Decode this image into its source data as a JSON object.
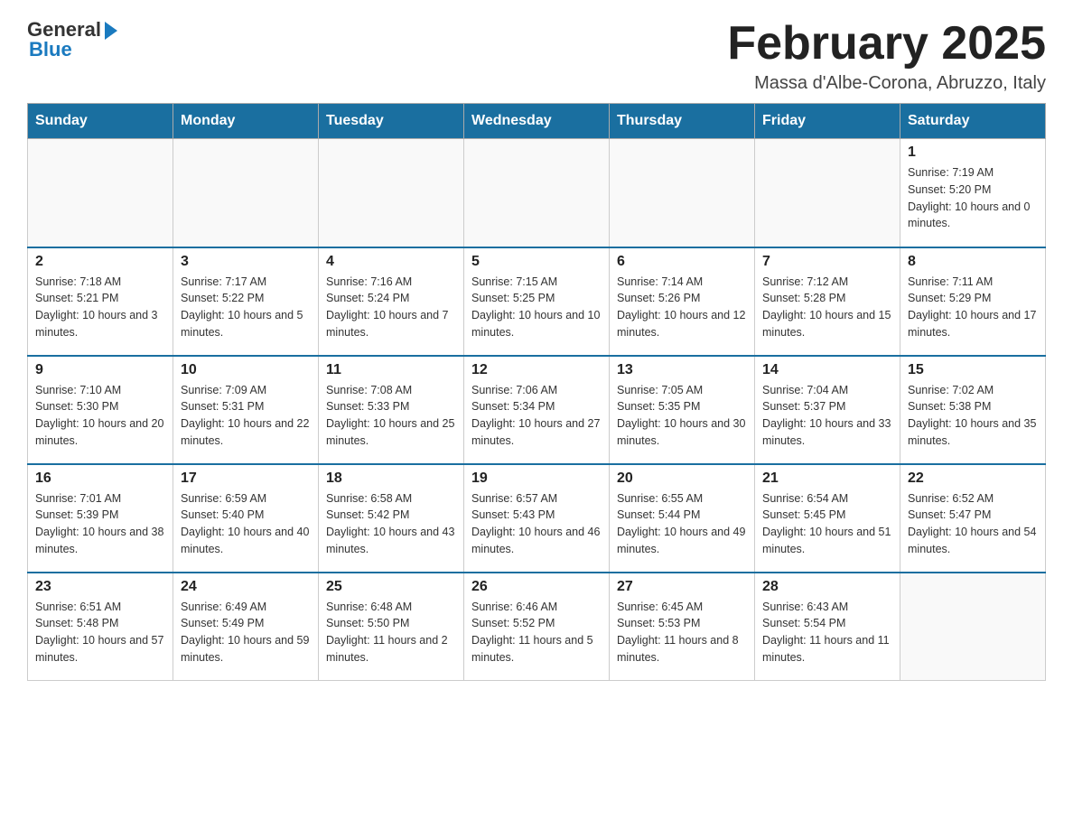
{
  "logo": {
    "general": "General",
    "blue": "Blue"
  },
  "title": "February 2025",
  "location": "Massa d'Albe-Corona, Abruzzo, Italy",
  "days_of_week": [
    "Sunday",
    "Monday",
    "Tuesday",
    "Wednesday",
    "Thursday",
    "Friday",
    "Saturday"
  ],
  "weeks": [
    [
      {
        "day": "",
        "info": ""
      },
      {
        "day": "",
        "info": ""
      },
      {
        "day": "",
        "info": ""
      },
      {
        "day": "",
        "info": ""
      },
      {
        "day": "",
        "info": ""
      },
      {
        "day": "",
        "info": ""
      },
      {
        "day": "1",
        "info": "Sunrise: 7:19 AM\nSunset: 5:20 PM\nDaylight: 10 hours and 0 minutes."
      }
    ],
    [
      {
        "day": "2",
        "info": "Sunrise: 7:18 AM\nSunset: 5:21 PM\nDaylight: 10 hours and 3 minutes."
      },
      {
        "day": "3",
        "info": "Sunrise: 7:17 AM\nSunset: 5:22 PM\nDaylight: 10 hours and 5 minutes."
      },
      {
        "day": "4",
        "info": "Sunrise: 7:16 AM\nSunset: 5:24 PM\nDaylight: 10 hours and 7 minutes."
      },
      {
        "day": "5",
        "info": "Sunrise: 7:15 AM\nSunset: 5:25 PM\nDaylight: 10 hours and 10 minutes."
      },
      {
        "day": "6",
        "info": "Sunrise: 7:14 AM\nSunset: 5:26 PM\nDaylight: 10 hours and 12 minutes."
      },
      {
        "day": "7",
        "info": "Sunrise: 7:12 AM\nSunset: 5:28 PM\nDaylight: 10 hours and 15 minutes."
      },
      {
        "day": "8",
        "info": "Sunrise: 7:11 AM\nSunset: 5:29 PM\nDaylight: 10 hours and 17 minutes."
      }
    ],
    [
      {
        "day": "9",
        "info": "Sunrise: 7:10 AM\nSunset: 5:30 PM\nDaylight: 10 hours and 20 minutes."
      },
      {
        "day": "10",
        "info": "Sunrise: 7:09 AM\nSunset: 5:31 PM\nDaylight: 10 hours and 22 minutes."
      },
      {
        "day": "11",
        "info": "Sunrise: 7:08 AM\nSunset: 5:33 PM\nDaylight: 10 hours and 25 minutes."
      },
      {
        "day": "12",
        "info": "Sunrise: 7:06 AM\nSunset: 5:34 PM\nDaylight: 10 hours and 27 minutes."
      },
      {
        "day": "13",
        "info": "Sunrise: 7:05 AM\nSunset: 5:35 PM\nDaylight: 10 hours and 30 minutes."
      },
      {
        "day": "14",
        "info": "Sunrise: 7:04 AM\nSunset: 5:37 PM\nDaylight: 10 hours and 33 minutes."
      },
      {
        "day": "15",
        "info": "Sunrise: 7:02 AM\nSunset: 5:38 PM\nDaylight: 10 hours and 35 minutes."
      }
    ],
    [
      {
        "day": "16",
        "info": "Sunrise: 7:01 AM\nSunset: 5:39 PM\nDaylight: 10 hours and 38 minutes."
      },
      {
        "day": "17",
        "info": "Sunrise: 6:59 AM\nSunset: 5:40 PM\nDaylight: 10 hours and 40 minutes."
      },
      {
        "day": "18",
        "info": "Sunrise: 6:58 AM\nSunset: 5:42 PM\nDaylight: 10 hours and 43 minutes."
      },
      {
        "day": "19",
        "info": "Sunrise: 6:57 AM\nSunset: 5:43 PM\nDaylight: 10 hours and 46 minutes."
      },
      {
        "day": "20",
        "info": "Sunrise: 6:55 AM\nSunset: 5:44 PM\nDaylight: 10 hours and 49 minutes."
      },
      {
        "day": "21",
        "info": "Sunrise: 6:54 AM\nSunset: 5:45 PM\nDaylight: 10 hours and 51 minutes."
      },
      {
        "day": "22",
        "info": "Sunrise: 6:52 AM\nSunset: 5:47 PM\nDaylight: 10 hours and 54 minutes."
      }
    ],
    [
      {
        "day": "23",
        "info": "Sunrise: 6:51 AM\nSunset: 5:48 PM\nDaylight: 10 hours and 57 minutes."
      },
      {
        "day": "24",
        "info": "Sunrise: 6:49 AM\nSunset: 5:49 PM\nDaylight: 10 hours and 59 minutes."
      },
      {
        "day": "25",
        "info": "Sunrise: 6:48 AM\nSunset: 5:50 PM\nDaylight: 11 hours and 2 minutes."
      },
      {
        "day": "26",
        "info": "Sunrise: 6:46 AM\nSunset: 5:52 PM\nDaylight: 11 hours and 5 minutes."
      },
      {
        "day": "27",
        "info": "Sunrise: 6:45 AM\nSunset: 5:53 PM\nDaylight: 11 hours and 8 minutes."
      },
      {
        "day": "28",
        "info": "Sunrise: 6:43 AM\nSunset: 5:54 PM\nDaylight: 11 hours and 11 minutes."
      },
      {
        "day": "",
        "info": ""
      }
    ]
  ]
}
